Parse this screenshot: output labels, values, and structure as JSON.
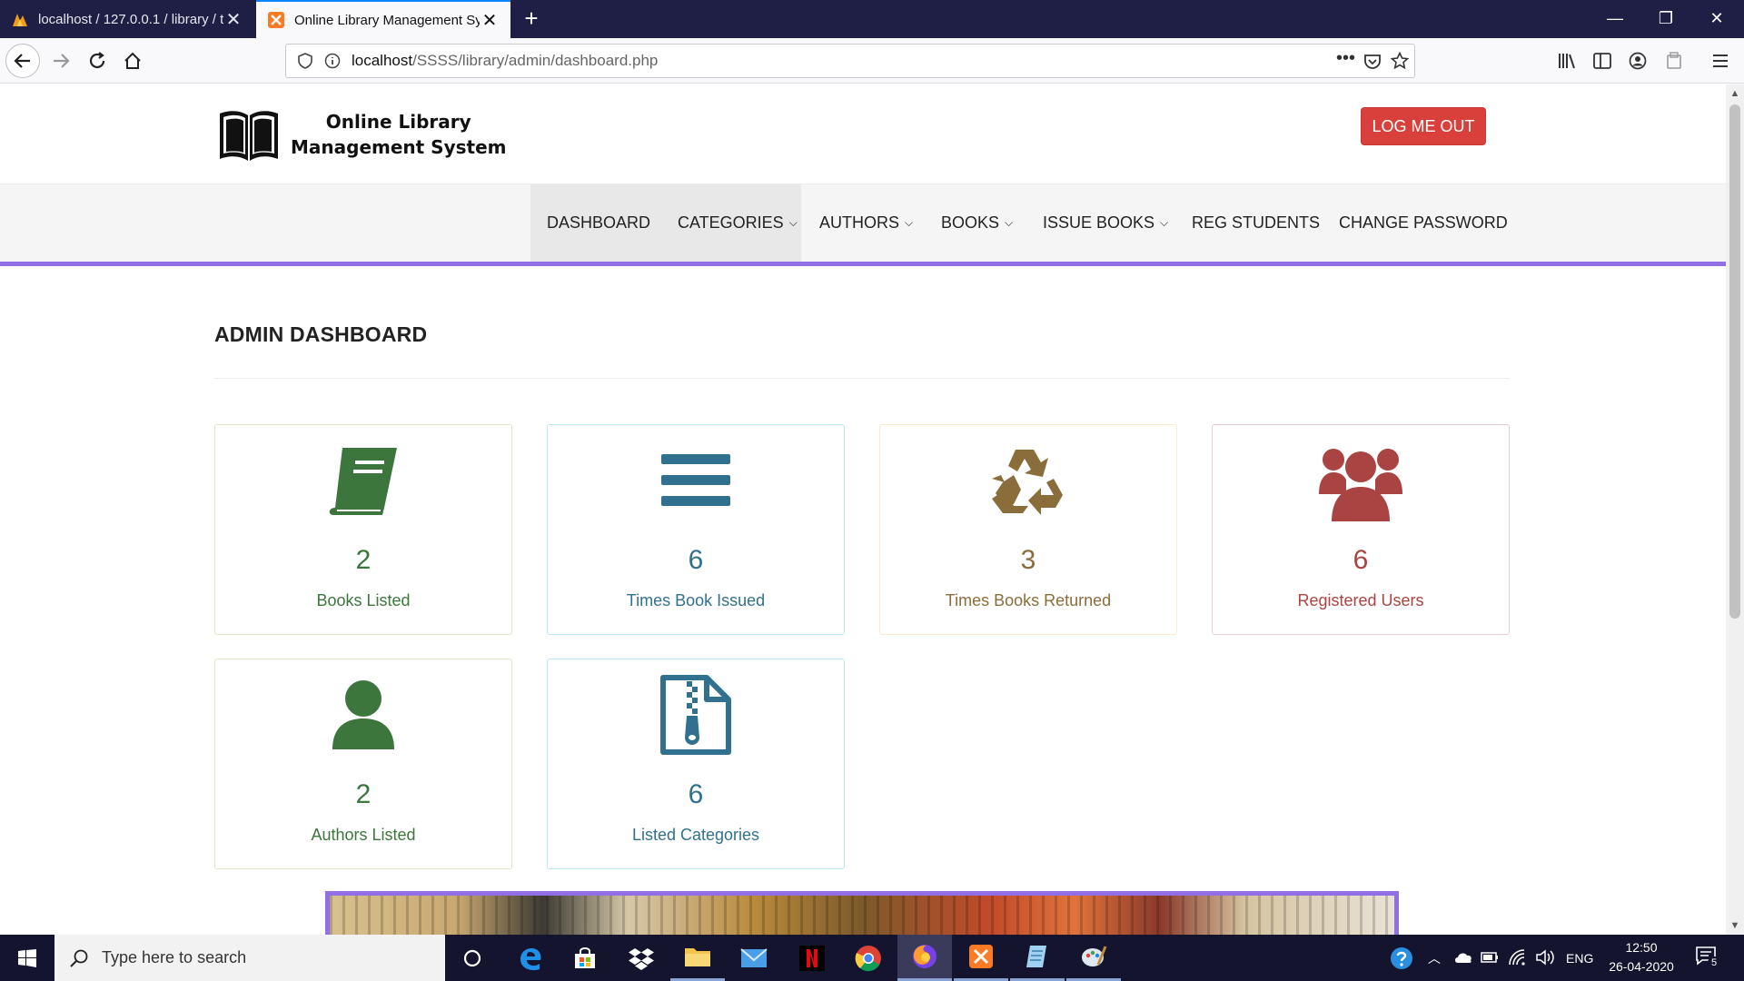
{
  "browser": {
    "tabs": [
      {
        "title": "localhost / 127.0.0.1 / library / t"
      },
      {
        "title": "Online Library Management Sy"
      }
    ],
    "url_host": "localhost",
    "url_path": "/SSSS/library/admin/dashboard.php"
  },
  "header": {
    "logo_line1": "Online Library",
    "logo_line2": "Management System",
    "logout_label": "LOG ME OUT"
  },
  "menu": {
    "items": [
      {
        "label": "DASHBOARD",
        "dropdown": false
      },
      {
        "label": "CATEGORIES",
        "dropdown": true
      },
      {
        "label": "AUTHORS",
        "dropdown": true
      },
      {
        "label": "BOOKS",
        "dropdown": true
      },
      {
        "label": "ISSUE BOOKS",
        "dropdown": true
      },
      {
        "label": "REG STUDENTS",
        "dropdown": false
      },
      {
        "label": "CHANGE PASSWORD",
        "dropdown": false
      }
    ],
    "caret": "⌄",
    "accent_color": "#9170e6"
  },
  "dashboard": {
    "title": "ADMIN DASHBOARD",
    "cards": [
      {
        "count": "2",
        "label": "Books Listed",
        "icon": "book-icon",
        "color": "#3c763d",
        "border": "#e0e6c8"
      },
      {
        "count": "6",
        "label": "Times Book Issued",
        "icon": "bars-icon",
        "color": "#31708f",
        "border": "#bce8f1"
      },
      {
        "count": "3",
        "label": "Times Books Returned",
        "icon": "recycle-icon",
        "color": "#8a6d3b",
        "border": "#faebcc"
      },
      {
        "count": "6",
        "label": "Registered Users",
        "icon": "users-icon",
        "color": "#a94442",
        "border": "#ebccd1"
      },
      {
        "count": "2",
        "label": "Authors Listed",
        "icon": "user-icon",
        "color": "#3c763d",
        "border": "#e0e6c8"
      },
      {
        "count": "6",
        "label": "Listed Categories",
        "icon": "file-archive-icon",
        "color": "#31708f",
        "border": "#bce8f1"
      }
    ]
  },
  "taskbar": {
    "search_placeholder": "Type here to search",
    "language": "ENG",
    "time": "12:50",
    "date": "26-04-2020",
    "notifications": "5"
  }
}
